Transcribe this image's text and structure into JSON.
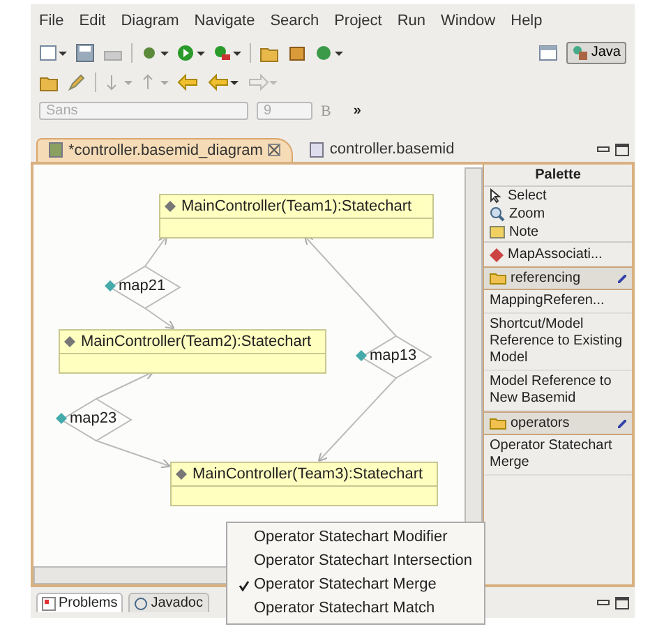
{
  "menu": [
    "File",
    "Edit",
    "Diagram",
    "Navigate",
    "Search",
    "Project",
    "Run",
    "Window",
    "Help"
  ],
  "perspective": {
    "label": "Java",
    "selected": true
  },
  "font_bar": {
    "font": "Sans",
    "size": "9",
    "bold": "B",
    "more": "»"
  },
  "editor_tabs": [
    {
      "label": "*controller.basemid_diagram",
      "selected": true
    },
    {
      "label": "controller.basemid",
      "selected": false
    }
  ],
  "diagram": {
    "nodes": [
      "MainController(Team1):Statechart",
      "MainController(Team2):Statechart",
      "MainController(Team3):Statechart"
    ],
    "mappings": [
      "map21",
      "map13",
      "map23"
    ]
  },
  "palette": {
    "title": "Palette",
    "tools": [
      {
        "label": "Select",
        "kind": "select"
      },
      {
        "label": "Zoom",
        "kind": "zoom"
      },
      {
        "label": "Note",
        "kind": "note"
      },
      {
        "label": "MapAssociati...",
        "kind": "association"
      }
    ],
    "drawers": [
      {
        "label": "referencing",
        "items": [
          "MappingReferen...",
          "Shortcut/Model Reference to Existing Model",
          "Model Reference to New Basemid"
        ]
      },
      {
        "label": "operators",
        "items": [
          "Operator Statechart Merge"
        ]
      }
    ]
  },
  "bottom_tabs": [
    {
      "label": "Problems",
      "selected": true
    },
    {
      "label": "Javadoc",
      "selected": false
    }
  ],
  "context_menu": [
    {
      "label": "Operator Statechart Modifier",
      "checked": false
    },
    {
      "label": "Operator Statechart Intersection",
      "checked": false
    },
    {
      "label": "Operator Statechart Merge",
      "checked": true
    },
    {
      "label": "Operator Statechart Match",
      "checked": false
    }
  ]
}
